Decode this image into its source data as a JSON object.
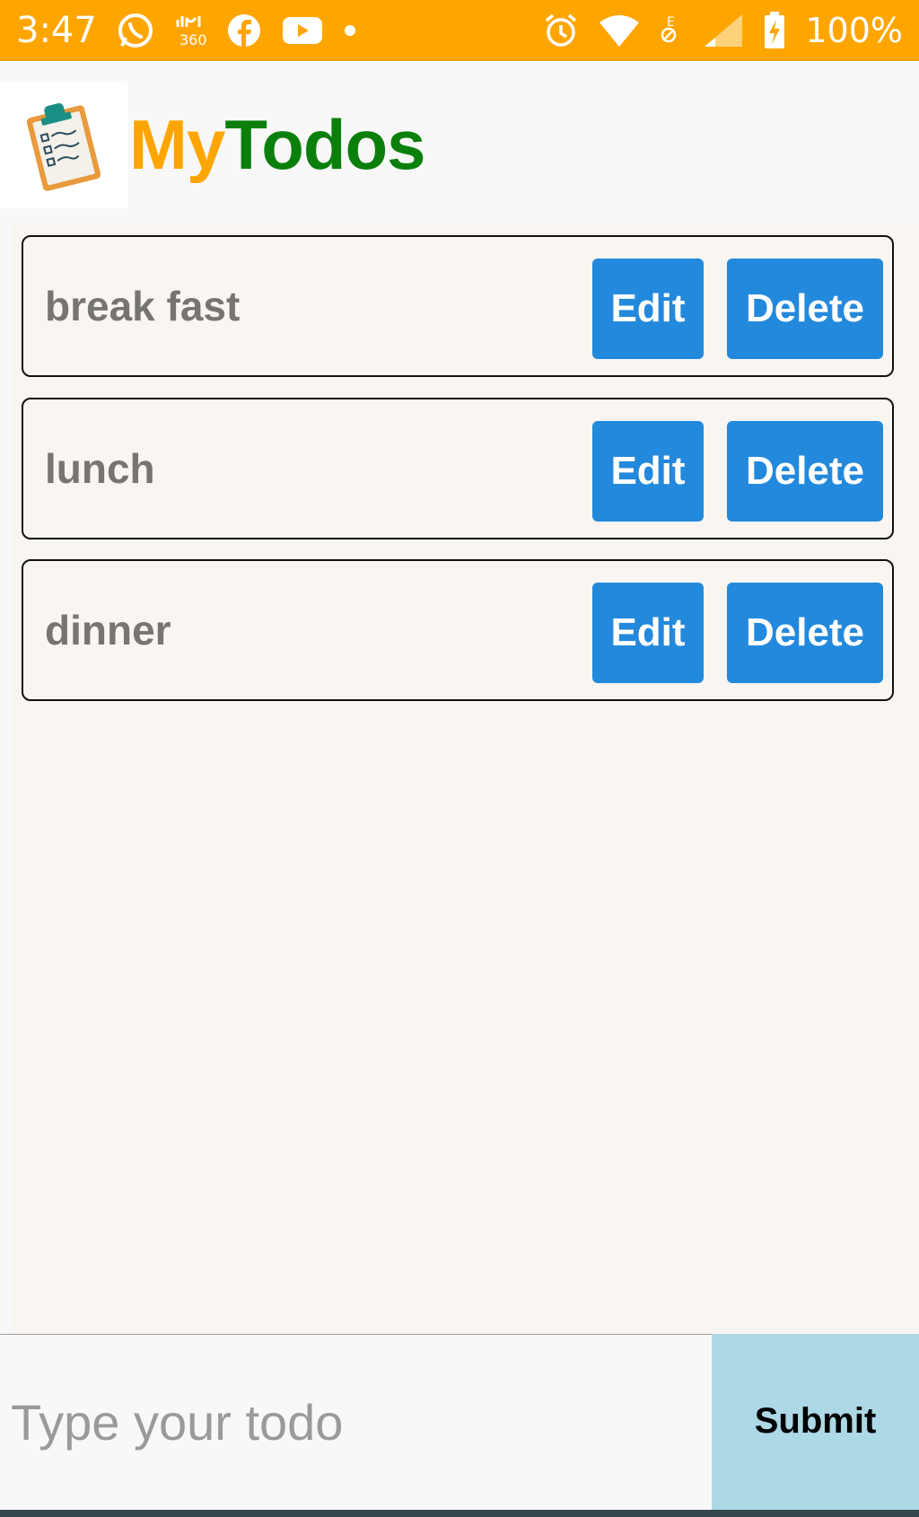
{
  "status_bar": {
    "time": "3:47",
    "battery_percent": "100%",
    "left_icons": [
      "whatsapp-icon",
      "arabic-360-icon",
      "facebook-icon",
      "youtube-icon",
      "dot-icon"
    ],
    "right_icons": [
      "alarm-icon",
      "wifi-icon",
      "data-off-icon",
      "signal-icon",
      "battery-charging-icon"
    ]
  },
  "header": {
    "logo_icon": "clipboard-checklist-icon",
    "title_part1": "My",
    "title_part2": "Todos"
  },
  "todos": [
    {
      "text": "break fast",
      "edit_label": "Edit",
      "delete_label": "Delete"
    },
    {
      "text": "lunch",
      "edit_label": "Edit",
      "delete_label": "Delete"
    },
    {
      "text": "dinner",
      "edit_label": "Edit",
      "delete_label": "Delete"
    }
  ],
  "input": {
    "placeholder": "Type your todo",
    "value": "",
    "submit_label": "Submit"
  },
  "colors": {
    "status_bar": "#FFA500",
    "title_my": "#FFA500",
    "title_todos": "#0B7F0B",
    "button": "#2389DC",
    "submit_button": "#ADD8E6",
    "todo_text": "#777572"
  }
}
